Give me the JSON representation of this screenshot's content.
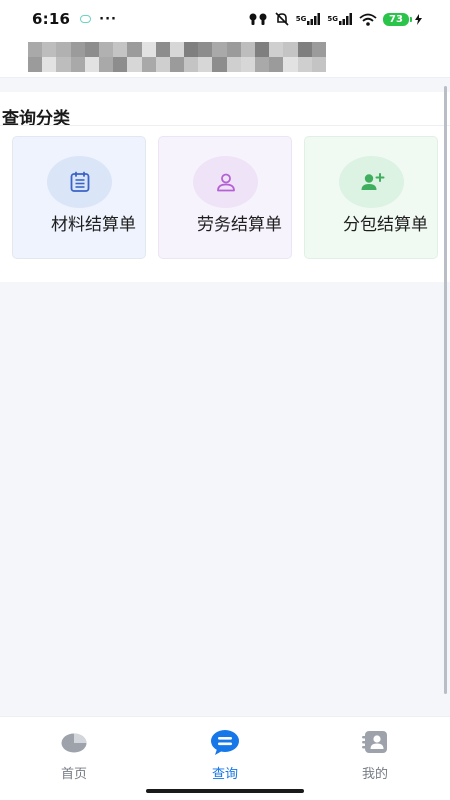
{
  "status_bar": {
    "time": "6:16",
    "more": "···",
    "signal_1_label": "5G",
    "signal_2_label": "5G",
    "battery": "73"
  },
  "header": {
    "title_redacted": true
  },
  "section": {
    "title": "查询分类",
    "cards": [
      {
        "label": "材料结算单",
        "icon": "document-list-icon",
        "color": "#3b63c7"
      },
      {
        "label": "劳务结算单",
        "icon": "person-icon",
        "color": "#b660d6"
      },
      {
        "label": "分包结算单",
        "icon": "add-person-icon",
        "color": "#3fae5e"
      }
    ]
  },
  "bottom_nav": {
    "items": [
      {
        "label": "首页",
        "icon": "home-pie-icon",
        "active": false
      },
      {
        "label": "查询",
        "icon": "chat-query-icon",
        "active": true
      },
      {
        "label": "我的",
        "icon": "contact-book-icon",
        "active": false
      }
    ],
    "active_color": "#1677e8",
    "inactive_color": "#777c85"
  }
}
